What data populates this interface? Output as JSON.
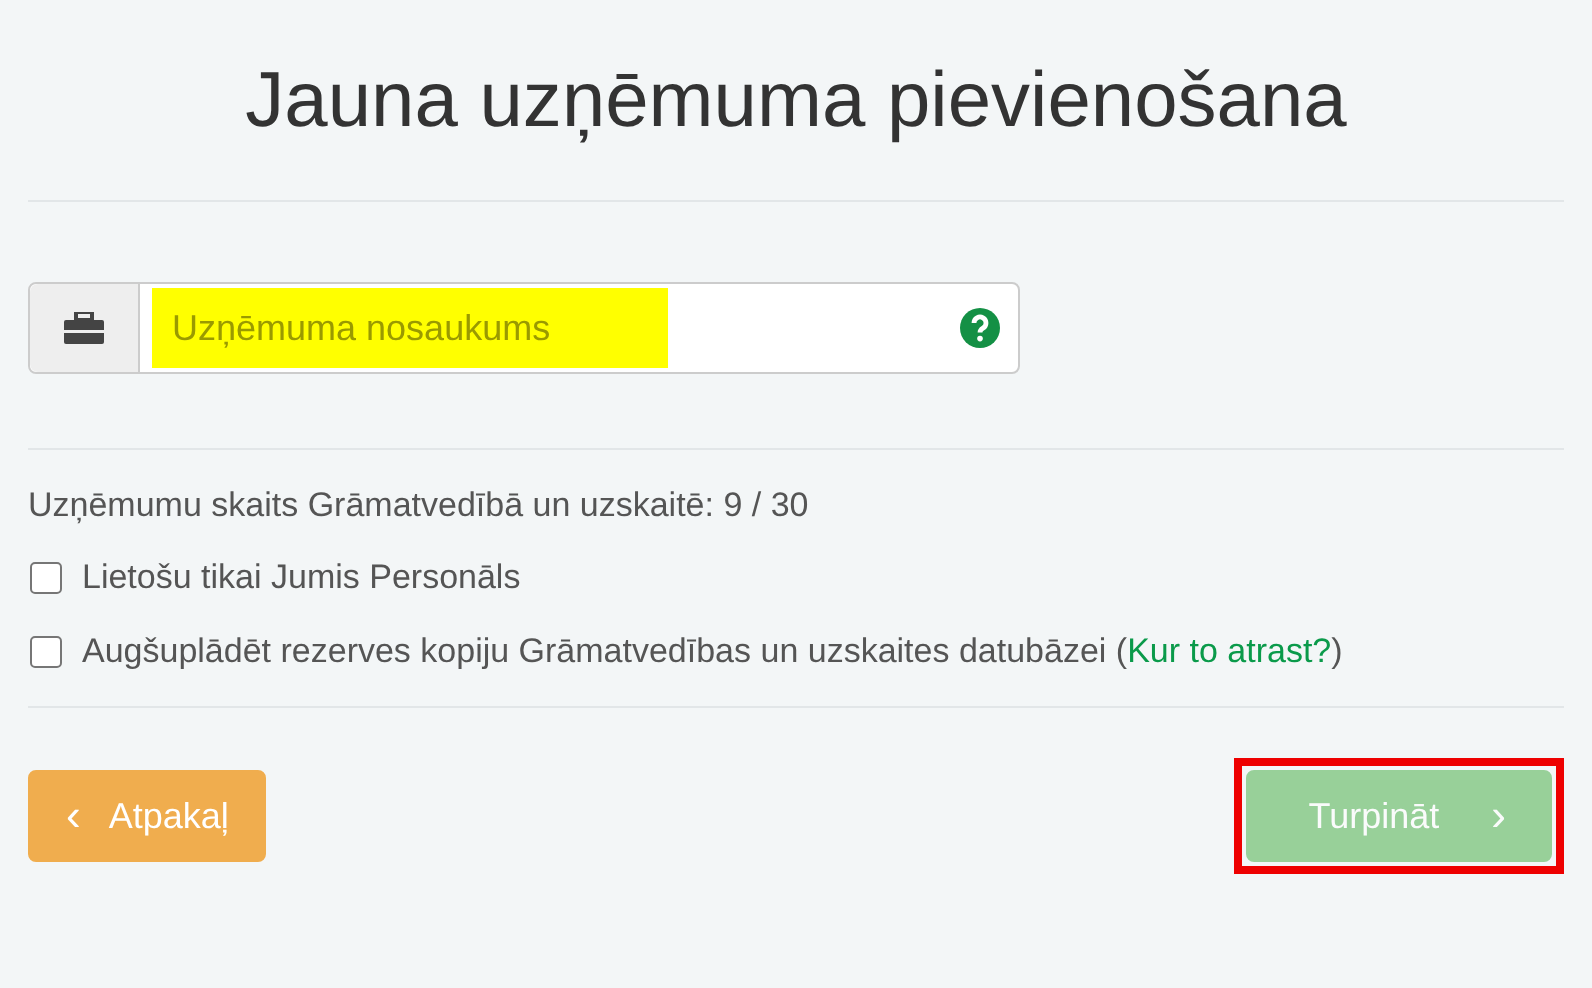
{
  "title": "Jauna uzņēmuma pievienošana",
  "company_field": {
    "placeholder": "Uzņēmuma nosaukums",
    "highlighted": true
  },
  "count_text": "Uzņēmumu skaits Grāmatvedībā un uzskaitē: 9 / 30",
  "options": [
    {
      "label": "Lietošu tikai Jumis Personāls",
      "checked": false
    },
    {
      "label": "Augšuplādēt rezerves kopiju Grāmatvedības un uzskaites datubāzei (",
      "link": "Kur to atrast?",
      "suffix": ")",
      "checked": false
    }
  ],
  "back_button": {
    "label": "Atpakaļ",
    "icon": "‹"
  },
  "continue_button": {
    "label": "Turpināt",
    "icon": "›",
    "disabled": true,
    "highlighted": true
  }
}
